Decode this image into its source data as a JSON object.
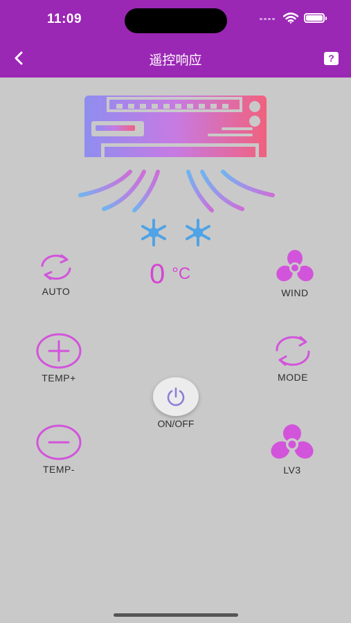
{
  "status": {
    "time": "11:09"
  },
  "header": {
    "title": "遥控响应",
    "help_label": "?"
  },
  "temperature": {
    "value": "0",
    "unit": "°C"
  },
  "controls": {
    "auto": "AUTO",
    "wind": "WIND",
    "temp_plus": "TEMP+",
    "mode": "MODE",
    "power": "ON/OFF",
    "temp_minus": "TEMP-",
    "level": "LV3"
  },
  "colors": {
    "header": "#9b27b5",
    "accent": "#d446d3",
    "background": "#c9c9c9",
    "snow": "#4fa3e6"
  }
}
